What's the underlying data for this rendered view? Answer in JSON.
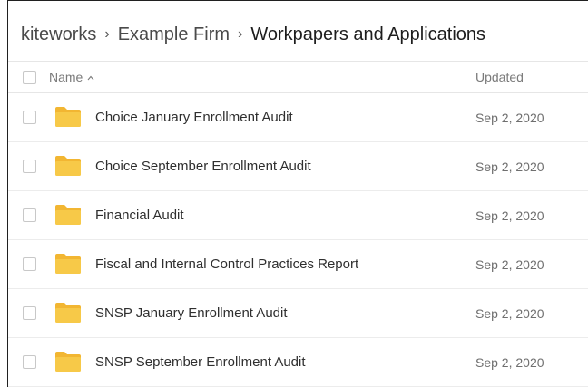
{
  "breadcrumb": {
    "items": [
      "kiteworks",
      "Example Firm",
      "Workpapers and Applications"
    ],
    "separator": "›"
  },
  "table": {
    "columns": {
      "name": "Name",
      "updated": "Updated"
    },
    "sort_icon": "chevron-up-icon",
    "rows": [
      {
        "name": "Choice January Enrollment Audit",
        "updated": "Sep 2, 2020"
      },
      {
        "name": "Choice September Enrollment Audit",
        "updated": "Sep 2, 2020"
      },
      {
        "name": "Financial Audit",
        "updated": "Sep 2, 2020"
      },
      {
        "name": "Fiscal and Internal Control Practices Report",
        "updated": "Sep 2, 2020"
      },
      {
        "name": "SNSP January Enrollment Audit",
        "updated": "Sep 2, 2020"
      },
      {
        "name": "SNSP September Enrollment Audit",
        "updated": "Sep 2, 2020"
      }
    ]
  },
  "colors": {
    "folder": "#f7c948",
    "folder_tab": "#f2b632",
    "text": "#2f2f2f",
    "muted": "#7a7a7a"
  },
  "icons": {
    "row_icon": "folder-icon"
  }
}
